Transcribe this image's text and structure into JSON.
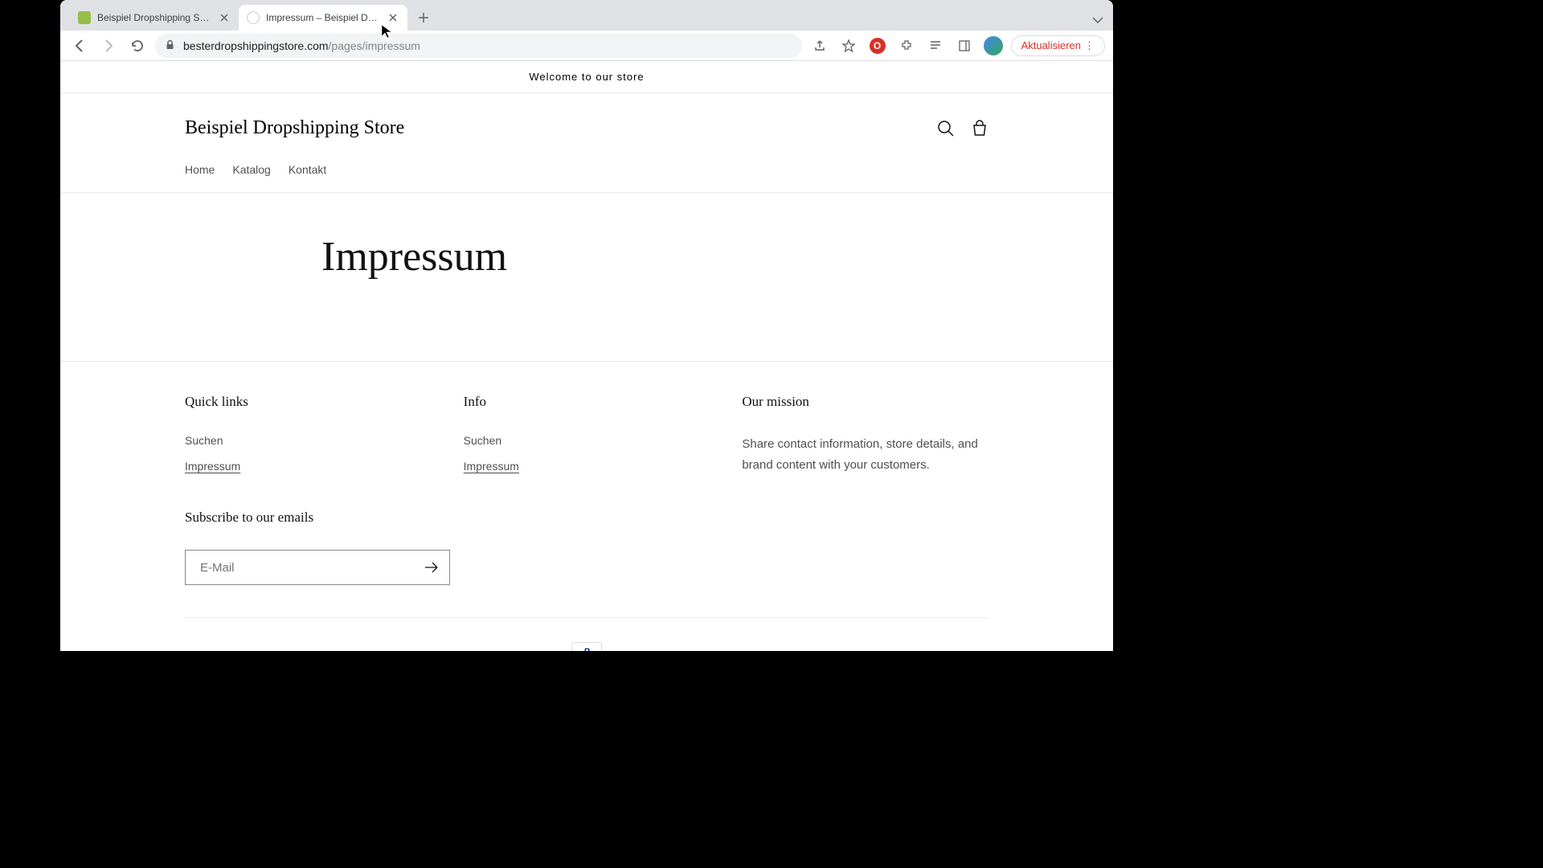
{
  "browser": {
    "tabs": [
      {
        "title": "Beispiel Dropshipping Store · F",
        "active": false,
        "favicon_color": "#96bf48"
      },
      {
        "title": "Impressum – Beispiel Dropship",
        "active": true,
        "favicon_color": "#888"
      }
    ],
    "url_domain": "besterdropshippingstore.com",
    "url_path": "/pages/impressum",
    "update_label": "Aktualisieren"
  },
  "store": {
    "announcement": "Welcome to our store",
    "name": "Beispiel Dropshipping Store",
    "nav": [
      "Home",
      "Katalog",
      "Kontakt"
    ],
    "page_title": "Impressum"
  },
  "footer": {
    "col1_heading": "Quick links",
    "col1_links": [
      "Suchen",
      "Impressum"
    ],
    "col2_heading": "Info",
    "col2_links": [
      "Suchen",
      "Impressum"
    ],
    "col3_heading": "Our mission",
    "mission_text": "Share contact information, store details, and brand content with your customers.",
    "subscribe_heading": "Subscribe to our emails",
    "email_placeholder": "E-Mail",
    "payment": "P"
  }
}
